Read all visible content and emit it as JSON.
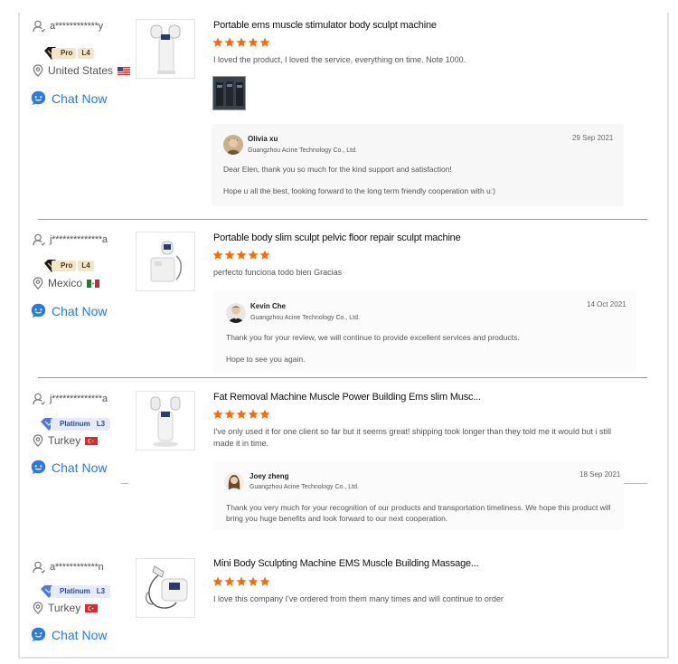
{
  "chat_label": "Chat Now",
  "colors": {
    "accent": "#2a7ae2",
    "star": "#ff6a00",
    "pro_badge": "#f3e6c8",
    "platinum_badge": "#e4ebfb"
  },
  "reviews": [
    {
      "user": "a************y",
      "badge": {
        "tier": "Pro",
        "level": "L4"
      },
      "country": "United States",
      "product_title": "Portable ems muscle stimulator body sculpt machine",
      "rating": 5,
      "comment": "I loved the product, I loved the service, everything on time.  Note 1000.",
      "reply": {
        "name": "Olivia xu",
        "company": "Guangzhou Acine Technology Co., Ltd.",
        "date": "29 Sep 2021",
        "text1": "Dear Elen, thank you so much for the kind support and satisfaction!",
        "text2": "Hope u all the best, looking forward to the long term friendly cooperation with u:)"
      }
    },
    {
      "user": "j**************a",
      "badge": {
        "tier": "Pro",
        "level": "L4"
      },
      "country": "Mexico",
      "product_title": "Portable body slim sculpt pelvic floor repair sculpt machine",
      "rating": 5,
      "comment": "perfecto funciona todo bien Gracias",
      "reply": {
        "name": "Kevin Che",
        "company": "Guangzhou Acine Technology Co., Ltd.",
        "date": "14 Oct 2021",
        "text1": "Thank you for your review, we will continue to provide excellent services and products.",
        "text2": "Hope to see you again."
      }
    },
    {
      "user": "j**************a",
      "badge": {
        "tier": "Platinum",
        "level": "L3"
      },
      "country": "Turkey",
      "product_title": "Fat Removal Machine Muscle Power Building Ems slim Musc...",
      "rating": 5,
      "comment": "I've only used it for one client so far but it seems great! shipping took longer than they told me it would but i still made it in time.",
      "reply": {
        "name": "Joey zheng",
        "company": "Guangzhou Acine Technology Co., Ltd.",
        "date": "18 Sep 2021",
        "text1": "Thank you very much for your recognition of our products and transportation timeliness. We hope this product will bring you huge benefits and look forward to our next cooperation."
      }
    },
    {
      "user": "a************n",
      "badge": {
        "tier": "Platinum",
        "level": "L3"
      },
      "country": "Turkey",
      "product_title": "Mini Body Sculpting Machine EMS Muscle Building Massage...",
      "rating": 5,
      "comment": "I love this company I've ordered from them many times and will continue to order"
    }
  ]
}
